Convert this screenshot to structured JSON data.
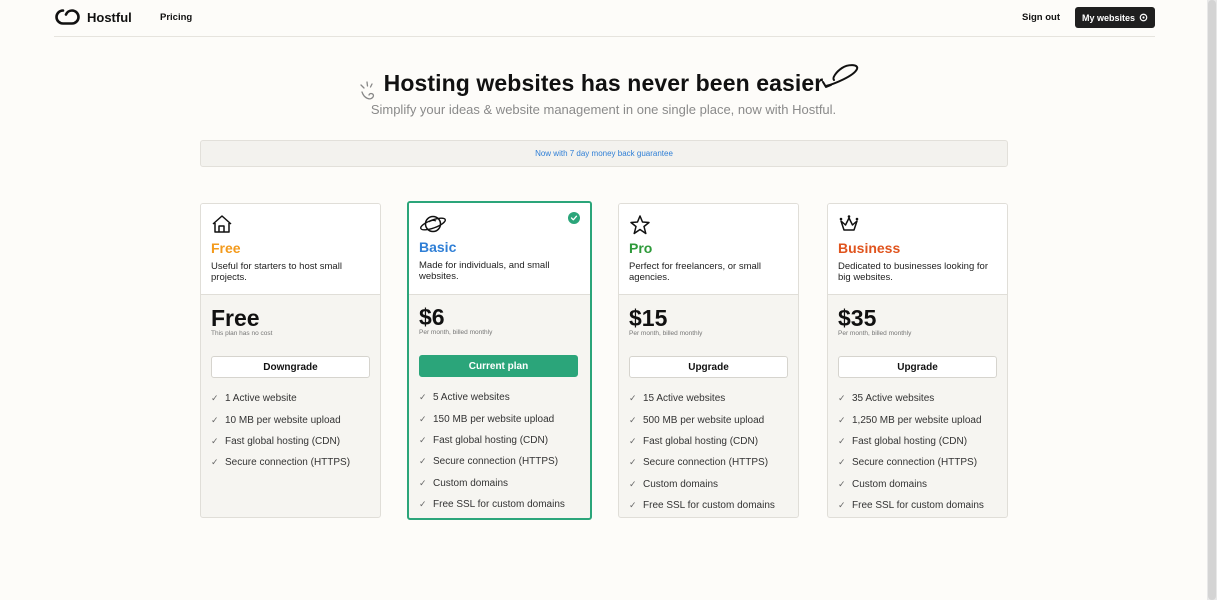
{
  "header": {
    "brand": "Hostful",
    "nav_pricing": "Pricing",
    "sign_out": "Sign out",
    "my_websites": "My websites"
  },
  "hero": {
    "title": "Hosting websites has never been easier",
    "subtitle": "Simplify your ideas & website management in one single place, now with Hostful."
  },
  "banner": "Now with 7 day money back guarantee",
  "colors": {
    "free": "#f39a1c",
    "basic": "#2f7fd6",
    "pro": "#2e9a3a",
    "business": "#e0541e",
    "accent_green": "#2ba57a"
  },
  "plans": [
    {
      "name": "Free",
      "icon": "house-icon",
      "description": "Useful for starters to host small projects.",
      "price": "Free",
      "price_note": "This plan has no cost",
      "button": "Downgrade",
      "features": [
        "1 Active website",
        "10 MB per website upload",
        "Fast global hosting (CDN)",
        "Secure connection (HTTPS)"
      ]
    },
    {
      "name": "Basic",
      "icon": "planet-icon",
      "description": "Made for individuals, and small websites.",
      "price": "$6",
      "price_note": "Per month, billed monthly",
      "button": "Current plan",
      "selected": true,
      "features": [
        "5 Active websites",
        "150 MB per website upload",
        "Fast global hosting (CDN)",
        "Secure connection (HTTPS)",
        "Custom domains",
        "Free SSL for custom domains"
      ]
    },
    {
      "name": "Pro",
      "icon": "star-icon",
      "description": "Perfect for freelancers, or small agencies.",
      "price": "$15",
      "price_note": "Per month, billed monthly",
      "button": "Upgrade",
      "features": [
        "15 Active websites",
        "500 MB per website upload",
        "Fast global hosting (CDN)",
        "Secure connection (HTTPS)",
        "Custom domains",
        "Free SSL for custom domains"
      ]
    },
    {
      "name": "Business",
      "icon": "crown-icon",
      "description": "Dedicated to businesses looking for big websites.",
      "price": "$35",
      "price_note": "Per month, billed monthly",
      "button": "Upgrade",
      "features": [
        "35 Active websites",
        "1,250 MB per website upload",
        "Fast global hosting (CDN)",
        "Secure connection (HTTPS)",
        "Custom domains",
        "Free SSL for custom domains"
      ]
    }
  ]
}
